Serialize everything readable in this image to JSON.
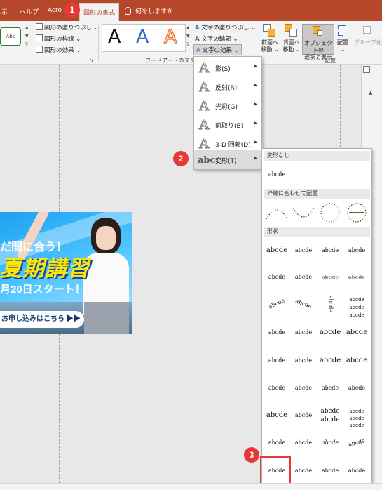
{
  "tabs": {
    "t1": "示",
    "t2": "ヘルプ",
    "t3": "Acro",
    "active": "図形の書式",
    "tellme": "何をしますか"
  },
  "ribbon": {
    "shape_sample": "Abc",
    "shape_fill": "図形の塗りつぶし",
    "shape_outline": "図形の枠線",
    "shape_effects": "図形の効果",
    "text_fill": "文字の塗りつぶし",
    "text_outline": "文字の輪郭",
    "text_effects": "文字の効果",
    "wordart_letter": "A",
    "wordart_group_label": "ワードアートのスタイル",
    "bring_forward_1": "前面へ",
    "bring_forward_2": "移動",
    "send_backward_1": "背面へ",
    "send_backward_2": "移動",
    "selection_pane_1": "オブジェクトの",
    "selection_pane_2": "選択と表示",
    "align": "配置",
    "group": "グループ化",
    "arrange_group_label": "配置"
  },
  "banner": {
    "line1": "だ間に合う！",
    "line2": "夏期講習",
    "line3": "月20日スタート！",
    "cta": "お申し込みはこちら ▶▶"
  },
  "effects_menu": [
    {
      "label": "影(S)"
    },
    {
      "label": "反射(R)"
    },
    {
      "label": "光彩(G)"
    },
    {
      "label": "面取り(B)"
    },
    {
      "label": "3-D 回転(D)"
    },
    {
      "label": "変形(T)",
      "icon_text": "abc"
    }
  ],
  "transform_menu": {
    "section_none": "変形なし",
    "none_sample": "abcde",
    "section_path": "枠線に合わせて配置",
    "path_samples": [
      "abcdefgh",
      "abcdefgh",
      "abcdefgh",
      "Ghijkl mnop"
    ],
    "section_warp": "形状",
    "warp_sample": "abcde",
    "warp_stack": "abcde"
  },
  "badges": {
    "b1": "1",
    "b2": "2",
    "b3": "3"
  },
  "colors": {
    "accent": "#b7472a",
    "badge": "#e53935",
    "wordart_blue": "#2f6fc4",
    "wordart_orange": "#f07a2c"
  }
}
